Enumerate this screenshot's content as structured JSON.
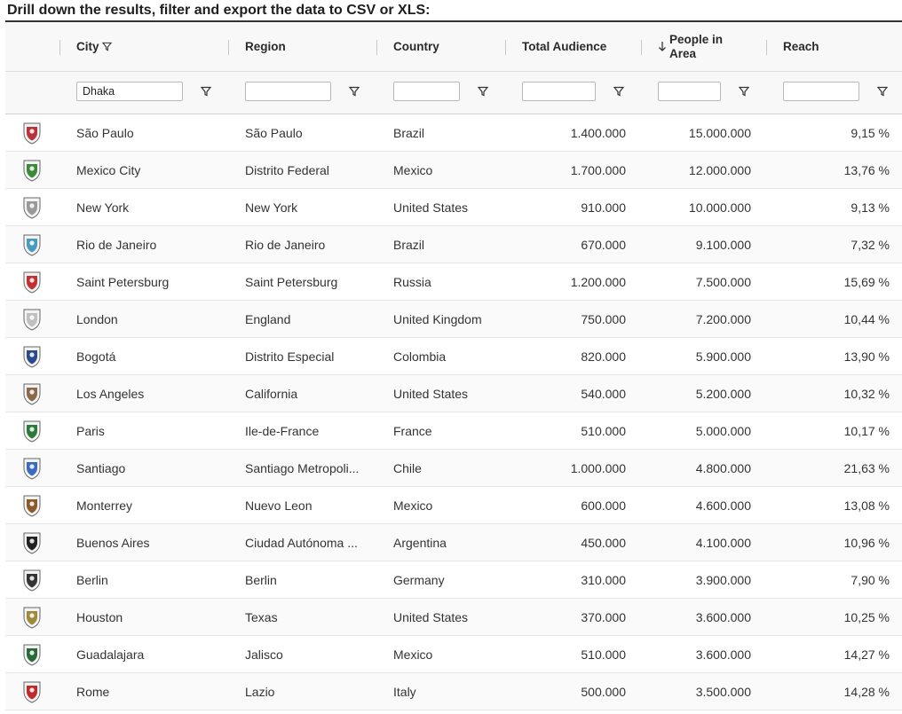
{
  "title": "Drill down the results, filter and export the data to CSV or XLS:",
  "columns": {
    "city": "City",
    "region": "Region",
    "country": "Country",
    "total_audience": "Total Audience",
    "people_line1": "People in",
    "people_line2": "Area",
    "reach": "Reach"
  },
  "filters": {
    "city": "Dhaka",
    "region": "",
    "country": "",
    "total_audience": "",
    "people": "",
    "reach": ""
  },
  "rows": [
    {
      "city": "São Paulo",
      "region": "São Paulo",
      "country": "Brazil",
      "audience": "1.400.000",
      "people": "15.000.000",
      "reach": "9,15 %",
      "flag_icon": "sao-paulo-coat-of-arms-icon",
      "color": "#b8323a"
    },
    {
      "city": "Mexico City",
      "region": "Distrito Federal",
      "country": "Mexico",
      "audience": "1.700.000",
      "people": "12.000.000",
      "reach": "13,76 %",
      "flag_icon": "mexico-city-coat-of-arms-icon",
      "color": "#3a8a3a"
    },
    {
      "city": "New York",
      "region": "New York",
      "country": "United States",
      "audience": "910.000",
      "people": "10.000.000",
      "reach": "9,13 %",
      "flag_icon": "new-york-seal-icon",
      "color": "#9a9a9a"
    },
    {
      "city": "Rio de Janeiro",
      "region": "Rio de Janeiro",
      "country": "Brazil",
      "audience": "670.000",
      "people": "9.100.000",
      "reach": "7,32 %",
      "flag_icon": "rio-coat-of-arms-icon",
      "color": "#4a9ac0"
    },
    {
      "city": "Saint Petersburg",
      "region": "Saint Petersburg",
      "country": "Russia",
      "audience": "1.200.000",
      "people": "7.500.000",
      "reach": "15,69 %",
      "flag_icon": "saint-petersburg-coat-of-arms-icon",
      "color": "#c03030"
    },
    {
      "city": "London",
      "region": "England",
      "country": "United Kingdom",
      "audience": "750.000",
      "people": "7.200.000",
      "reach": "10,44 %",
      "flag_icon": "london-coat-of-arms-icon",
      "color": "#c0c0c0"
    },
    {
      "city": "Bogotá",
      "region": "Distrito Especial",
      "country": "Colombia",
      "audience": "820.000",
      "people": "5.900.000",
      "reach": "13,90 %",
      "flag_icon": "bogota-coat-of-arms-icon",
      "color": "#2a4a8a"
    },
    {
      "city": "Los Angeles",
      "region": "California",
      "country": "United States",
      "audience": "540.000",
      "people": "5.200.000",
      "reach": "10,32 %",
      "flag_icon": "los-angeles-seal-icon",
      "color": "#8a6a4a"
    },
    {
      "city": "Paris",
      "region": "Ile-de-France",
      "country": "France",
      "audience": "510.000",
      "people": "5.000.000",
      "reach": "10,17 %",
      "flag_icon": "paris-coat-of-arms-icon",
      "color": "#2a7a3a"
    },
    {
      "city": "Santiago",
      "region": "Santiago Metropoli...",
      "country": "Chile",
      "audience": "1.000.000",
      "people": "4.800.000",
      "reach": "21,63 %",
      "flag_icon": "santiago-coat-of-arms-icon",
      "color": "#3a6ac0"
    },
    {
      "city": "Monterrey",
      "region": "Nuevo Leon",
      "country": "Mexico",
      "audience": "600.000",
      "people": "4.600.000",
      "reach": "13,08 %",
      "flag_icon": "monterrey-coat-of-arms-icon",
      "color": "#8a5a2a"
    },
    {
      "city": "Buenos Aires",
      "region": "Ciudad Autónoma ...",
      "country": "Argentina",
      "audience": "450.000",
      "people": "4.100.000",
      "reach": "10,96 %",
      "flag_icon": "buenos-aires-coat-of-arms-icon",
      "color": "#222222"
    },
    {
      "city": "Berlin",
      "region": "Berlin",
      "country": "Germany",
      "audience": "310.000",
      "people": "3.900.000",
      "reach": "7,90 %",
      "flag_icon": "berlin-bear-icon",
      "color": "#333333"
    },
    {
      "city": "Houston",
      "region": "Texas",
      "country": "United States",
      "audience": "370.000",
      "people": "3.600.000",
      "reach": "10,25 %",
      "flag_icon": "houston-seal-icon",
      "color": "#a08a3a"
    },
    {
      "city": "Guadalajara",
      "region": "Jalisco",
      "country": "Mexico",
      "audience": "510.000",
      "people": "3.600.000",
      "reach": "14,27 %",
      "flag_icon": "guadalajara-coat-of-arms-icon",
      "color": "#2a6a3a"
    },
    {
      "city": "Rome",
      "region": "Lazio",
      "country": "Italy",
      "audience": "500.000",
      "people": "3.500.000",
      "reach": "14,28 %",
      "flag_icon": "rome-coat-of-arms-icon",
      "color": "#c02a2a"
    }
  ]
}
